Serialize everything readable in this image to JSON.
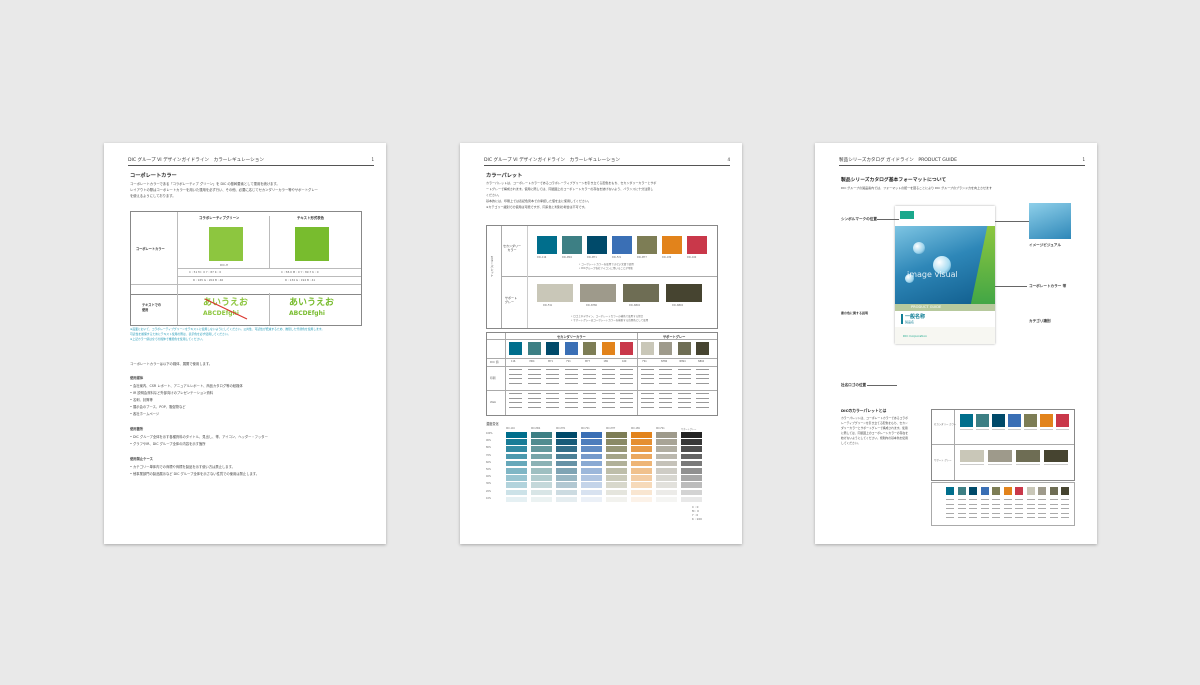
{
  "page1": {
    "header": "DIC グループ VI デザインガイドライン　カラーレギュレーション",
    "page_num": "1",
    "section_title": "コーポレートカラー",
    "intro": [
      "コーポレートカラーである「コラボレーティブ グリーン」を DIC の基幹要素として運用を続けます。",
      "レイアウトの際はコーポレートカラーを用いた運用を必ず行い、その他、必要に応じてセカンダリーカラー等やサポートグレー",
      "を使えるようにしております。"
    ],
    "table": {
      "col1": "コラボレーティブグリーン",
      "col2": "テキスト形式表色",
      "row1": "コーポレートカラー",
      "row2": "テキストでの\n使用",
      "dic1": "DIC-H",
      "dic2": "DIC-H",
      "cmyk1": "C : 51  M : 0  Y : 87  K : 0",
      "cmyk2": "C : 58.0  M : 0  Y : 89.7  K : 0",
      "rgb1": "R : 165  G : 204  B : 46",
      "rgb2": "R : 134  G : 194  B : 41",
      "hira": "あいうえお",
      "abc": "ABCDEfghi",
      "color1": "#8dc63f",
      "color2": "#78bc2e"
    },
    "notes": [
      "※画面において、コラボレーティブグリーンをテキストに使用しないようにしてください。公共性、可読性が低減するため、推奨した代替色を使用します。",
      "可読性を確保するためにテキスト使用の際は、表示色を必ず使用してください。",
      "※上記カラー値は全ての媒体で推奨色を使用してください。"
    ],
    "body_line": "コーポレートカラーは以下の媒体、展開で使用します。",
    "use_title": "使用媒体",
    "use_items": [
      "• 会社案内、CSR レポート、アニュアルレポート、商品カタログ等の紙媒体",
      "• IR 説明会資料など外部向けのプレゼンテーション資料",
      "• 名刺、封筒等",
      "• 展示会のブース、POP、販促物など",
      "• 各社ホームページ"
    ],
    "apply_title": "使用箇所",
    "apply_items": [
      "• DIC グループ全体を示す各種資料のタイトル、見出し、帯、アイコン、ヘッダー・フッター",
      "• グラフやIR、DIC グループ全体の内容を示す箇所"
    ],
    "ng_title": "使用禁止ケース",
    "ng_items": [
      "• カテゴリー単体内での商標や商標を製品を示す使い方は禁止します。",
      "• 他事業部門の製品展示など DIC グループ全体を示さない性質での使用は禁止します。"
    ]
  },
  "page2": {
    "header": "DIC グループ VI デザインガイドライン　カラーレギュレーション",
    "page_num": "4",
    "section_title": "カラーパレット",
    "intro": [
      "カラーパレットは、コーポレートカラーであるコラボレーティブグリーンを引き立てる配色をもち、セカンダリーカラーとサポ",
      "ートグレーで構成されます。使用に際しては、同範囲上のコーポレートカラーの存在を妨げないよう、バランスに十分注意し",
      "ください。",
      "基本的には、印刷上では表記色見本での承認した値を主に使用してください。",
      "※カテゴリー識別での使用は可能ですが、同系色と判別の場合は不可です。"
    ],
    "side_label": "カラーパレット",
    "secondary_label": "セカンダリー\nカラー",
    "support_label": "サポート\nグレー",
    "secondary_codes": [
      "DIC-116",
      "DIC-M04",
      "DIC-M71",
      "DIC-F21",
      "DIC-M77",
      "DIC-189",
      "DIC-160"
    ],
    "support_codes": [
      "DIC-F41",
      "DIC-N786",
      "DIC-N894",
      "DIC-N894"
    ],
    "secondary_note": [
      "• コーポレートカラーを使用できない文書で使用",
      "• DICグループ各社アイコンに用いることが可能"
    ],
    "support_note": [
      "• ロゴ上やデザイン、コーポレートカラーの補色で使用する場合",
      "• サポートグレーはコーポレートカラーを補助する背景色として使用"
    ],
    "secondary_colors": [
      "#006e8c",
      "#3d7f84",
      "#004a6a",
      "#3a6fb5",
      "#7d7d55",
      "#e2831b",
      "#c9384a"
    ],
    "support_colors": [
      "#c9c7b8",
      "#9e9a8b",
      "#6e6d54",
      "#464430"
    ],
    "table_header_secondary": "セカンダリーカラー",
    "table_header_support": "サポートグレー",
    "table_codes": [
      "116",
      "M04",
      "M71",
      "F21",
      "M77",
      "189",
      "160",
      "F41",
      "N786",
      "N894",
      "N894"
    ],
    "table_row_labels": [
      "DIC 値",
      "印刷",
      "Web"
    ],
    "ramp_title": "濃度変化",
    "ramp_percent": [
      "100%",
      "90%",
      "80%",
      "70%",
      "60%",
      "50%",
      "40%",
      "30%",
      "20%",
      "10%"
    ],
    "ramp_codes": [
      "DIC-116",
      "DIC-M04",
      "DIC-M71",
      "DIC-F21",
      "DIC-M77",
      "DIC-189",
      "DIC-F41",
      "サポートグレー"
    ],
    "ramp_note": [
      "C : 0",
      "M : 0",
      "Y : 0",
      "K : 100"
    ]
  },
  "page3": {
    "header": "製品シリーズカタログ ガイドライン　PRODUCT GUIDE",
    "page_num": "1",
    "section_title": "製品シリーズカタログ基本フォーマットについて",
    "intro": "DIC グループの製品案内では、フォーマットの統一を図ることにより DIC グループのブランド力を向上させます",
    "labels_left": [
      "シンボルマークの位置",
      "要の色に関する説明",
      "社名ロゴの位置"
    ],
    "labels_right": [
      "イメージビジュアル",
      "コーポレートカラー 帯",
      "カテゴリ識別"
    ],
    "cover_visual": "image visual",
    "cover_band": "PRODUCT GUIDE",
    "cover_product": "一般名称",
    "cover_product_sub": "製品名",
    "cover_corp": "DIC Corporation",
    "lower_title": "DICのカラーパレットとは",
    "lower_text": [
      "カラーパレットは、コーポレートカラーであるコラボ",
      "レーティブグリーンを引き立てる配色をもち、セカン",
      "ダリーカラーとサポートグレーで構成されます。使用",
      "に際しては、同範囲上のコーポレートカラーの存在を",
      "妨げないようにしてください。規則内の基本色を使用",
      "してください。"
    ],
    "mini_secondary_label": "セカンダリー カラー",
    "mini_support_label": "サポート グレー"
  }
}
